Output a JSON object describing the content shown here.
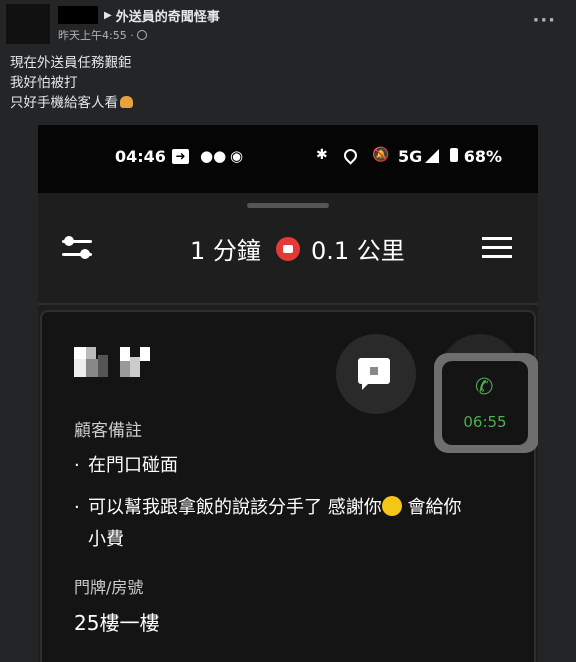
{
  "post": {
    "group_name": "外送員的奇聞怪事",
    "timestamp": "昨天上午4:55 ·",
    "more": "···",
    "lines": [
      "現在外送員任務艱鉅",
      "我好怕被打",
      "只好手機給客人看"
    ]
  },
  "phone": {
    "status": {
      "time": "04:46",
      "network": "5G",
      "battery": "68%"
    },
    "eta": "1 分鐘",
    "distance": "0.1 公里",
    "call_timer": "06:55",
    "customer_notes_label": "顧客備註",
    "notes": [
      "在門口碰面",
      "可以幫我跟拿飯的說該分手了 感謝你",
      "會給你",
      "小費"
    ],
    "door_label": "門牌/房號",
    "door_value": "25樓一樓",
    "bullet": "·"
  },
  "colors": {
    "call_green": "#4caf50",
    "bag_red": "#e53935"
  }
}
